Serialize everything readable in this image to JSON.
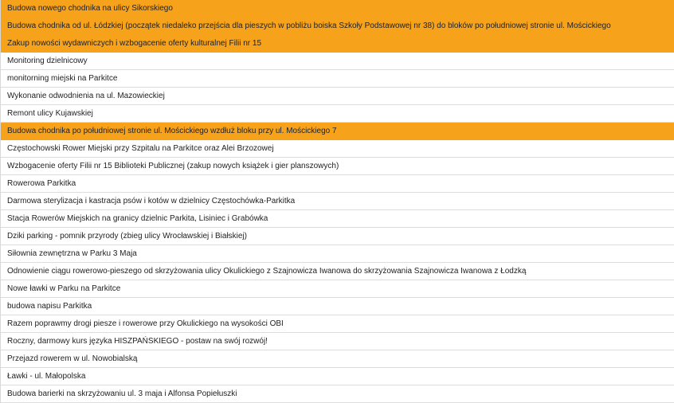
{
  "projects": [
    {
      "title": "Budowa nowego chodnika na ulicy Sikorskiego",
      "highlighted": true
    },
    {
      "title": "Budowa chodnika od ul. Łódzkiej (początek niedaleko przejścia dla pieszych w pobliżu boiska Szkoły Podstawowej nr 38) do bloków po południowej stronie ul. Mościckiego",
      "highlighted": true
    },
    {
      "title": "Zakup nowości wydawniczych i wzbogacenie oferty kulturalnej Filii nr 15",
      "highlighted": true
    },
    {
      "title": "Monitoring dzielnicowy",
      "highlighted": false
    },
    {
      "title": "monitorning miejski na Parkitce",
      "highlighted": false
    },
    {
      "title": "Wykonanie odwodnienia na ul. Mazowieckiej",
      "highlighted": false
    },
    {
      "title": "Remont ulicy Kujawskiej",
      "highlighted": false
    },
    {
      "title": "Budowa chodnika po południowej stronie ul. Mościckiego wzdłuż bloku przy ul. Mościckiego 7",
      "highlighted": true
    },
    {
      "title": "Częstochowski Rower Miejski przy Szpitalu na Parkitce oraz Alei Brzozowej",
      "highlighted": false
    },
    {
      "title": "Wzbogacenie oferty Filii nr 15 Biblioteki Publicznej (zakup nowych książek i gier planszowych)",
      "highlighted": false
    },
    {
      "title": "Rowerowa Parkitka",
      "highlighted": false
    },
    {
      "title": "Darmowa sterylizacja i kastracja psów i kotów w dzielnicy Częstochówka-Parkitka",
      "highlighted": false
    },
    {
      "title": "Stacja Rowerów Miejskich na granicy dzielnic Parkita, Lisiniec i Grabówka",
      "highlighted": false
    },
    {
      "title": "Dziki parking - pomnik przyrody (zbieg ulicy Wrocławskiej i Białskiej)",
      "highlighted": false
    },
    {
      "title": "Siłownia zewnętrzna w Parku 3 Maja",
      "highlighted": false
    },
    {
      "title": "Odnowienie ciągu rowerowo-pieszego od skrzyżowania ulicy Okulickiego z Szajnowicza Iwanowa do skrzyżowania Szajnowicza Iwanowa z Łodzką",
      "highlighted": false
    },
    {
      "title": "Nowe ławki w Parku na Parkitce",
      "highlighted": false
    },
    {
      "title": "budowa napisu Parkitka",
      "highlighted": false
    },
    {
      "title": "Razem poprawmy drogi piesze i rowerowe przy Okulickiego na wysokości OBI",
      "highlighted": false
    },
    {
      "title": "Roczny, darmowy kurs języka HISZPAŃSKIEGO - postaw na swój rozwój!",
      "highlighted": false
    },
    {
      "title": "Przejazd rowerem w ul. Nowobialską",
      "highlighted": false
    },
    {
      "title": "Ławki - ul. Małopolska",
      "highlighted": false
    },
    {
      "title": "Budowa barierki na skrzyżowaniu ul. 3 maja i Alfonsa Popiełuszki",
      "highlighted": false
    }
  ],
  "colors": {
    "highlight": "#f7a21b",
    "divider": "#dcdcdc",
    "text": "#222222"
  }
}
